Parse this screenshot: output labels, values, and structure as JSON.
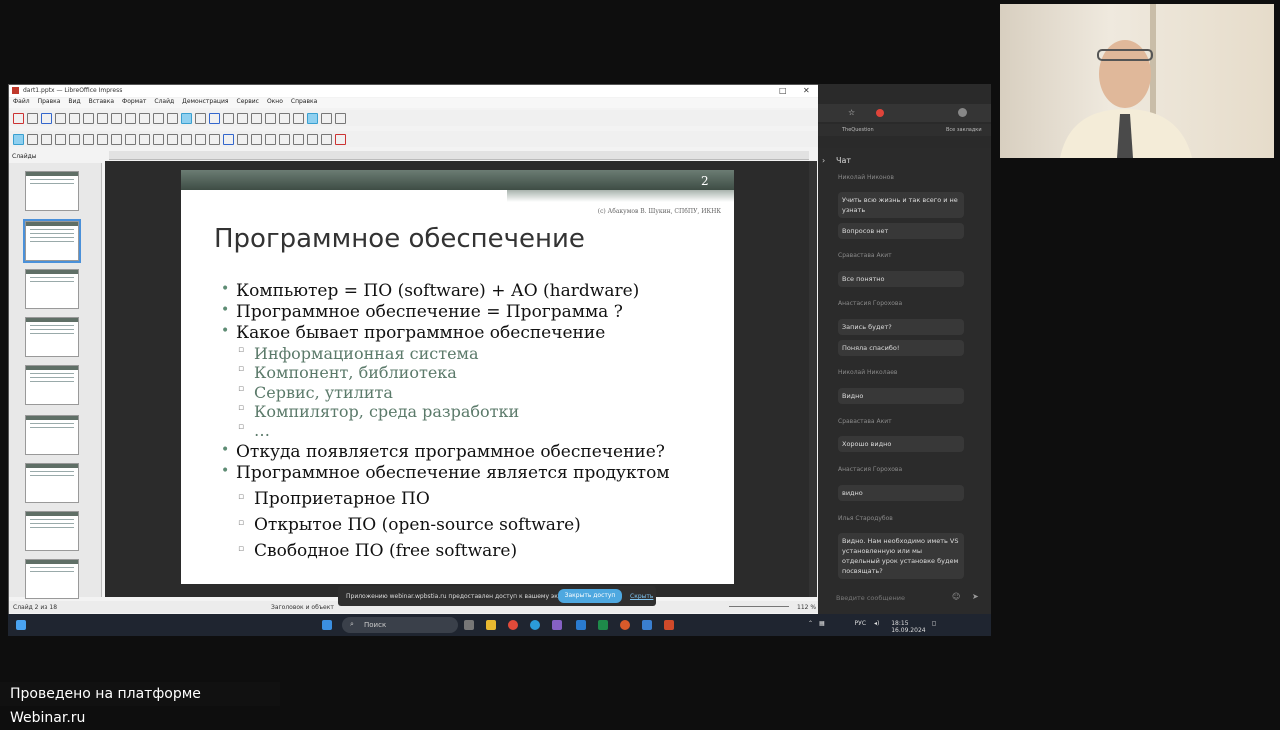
{
  "impress": {
    "window_title": "dart1.pptx — LibreOffice Impress",
    "menu": [
      "Файл",
      "Правка",
      "Вид",
      "Вставка",
      "Формат",
      "Слайд",
      "Демонстрация",
      "Сервис",
      "Окно",
      "Справка"
    ],
    "panel_label": "Слайды",
    "status_left": "Слайд 2 из 18",
    "status_mid": "Заголовок и объект",
    "zoom": "112 %"
  },
  "slide": {
    "number": "2",
    "credit": "(с) Абакумов В. Шукин, СПбПУ, ИКНК",
    "title": "Программное обеспечение",
    "bullets": [
      "Компьютер = ПО (software) + АО (hardware)",
      "Программное обеспечение = Программа ?",
      "Какое бывает программное обеспечение"
    ],
    "sub_kinds": [
      "Информационная система",
      "Компонент, библиотека",
      "Сервис, утилита",
      "Компилятор, среда разработки",
      "…"
    ],
    "bullets2": [
      "Откуда появляется программное обеспечение?",
      "Программное обеспечение является продуктом"
    ],
    "sub_product": [
      "Проприетарное ПО",
      "Открытое ПО (open-source software)",
      "Свободное ПО (free software)"
    ]
  },
  "notification": {
    "message": "Приложению webinar.wpbstia.ru предоставлен доступ к вашему экрану",
    "stop_button": "Закрыть доступ",
    "hide_link": "Скрыть"
  },
  "taskbar": {
    "search_placeholder": "Поиск",
    "lang": "РУС",
    "time": "18:15",
    "date": "16.09.2024"
  },
  "browser": {
    "bookmark1": "TheQuestion",
    "bookmark2": "Все закладки"
  },
  "chat": {
    "title": "Чат",
    "messages": [
      {
        "name": "Николай Никонов",
        "text": "Учить всю жизнь и так всего и не узнать"
      },
      {
        "name": "",
        "text": "Вопросов нет"
      },
      {
        "name": "Сравастава Акит",
        "text": "Все понятно"
      },
      {
        "name": "Анастасия Горохова",
        "text": "Запись будет?"
      },
      {
        "name": "",
        "text": "Поняла спасибо!"
      },
      {
        "name": "Николай Николаев",
        "text": "Видно"
      },
      {
        "name": "Сравастава Акит",
        "text": "Хорошо видно"
      },
      {
        "name": "Анастасия Горохова",
        "text": "видно"
      },
      {
        "name": "Илья Стародубов",
        "text": "Видно. Нам необходимо иметь VS установленную или мы отдельный урок установке будем посвящать?"
      }
    ],
    "input_placeholder": "Введите сообщение"
  },
  "footer": {
    "text": "Проведено на платформе Webinar.ru"
  }
}
